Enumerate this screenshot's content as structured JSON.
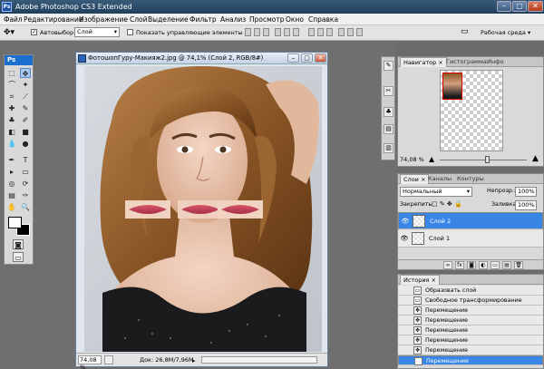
{
  "app": {
    "title": "Adobe Photoshop CS3 Extended",
    "logo": "Ps"
  },
  "menu": [
    "Файл",
    "Редактирование",
    "Изображение",
    "Слой",
    "Выделение",
    "Фильтр",
    "Анализ",
    "Просмотр",
    "Окно",
    "Справка"
  ],
  "options": {
    "autoselect_label": "Автовыбор:",
    "autoselect_value": "Слой",
    "show_controls_label": "Показать управляющие элементы",
    "workspace_label": "Рабочая среда"
  },
  "document": {
    "title": "ФотошопГуру-Макияж2.jpg @ 74,1% (Слой 2, RGB/8#)",
    "zoom": "74,08 %",
    "info": "Док: 26,8M/7,96M"
  },
  "navigator": {
    "tabs": [
      "Навигатор",
      "Гистограмма",
      "Инфо"
    ],
    "active_tab": 0,
    "zoom": "74,08 %",
    "zoom_level_fraction": 0.55
  },
  "layers": {
    "tabs": [
      "Слои",
      "Каналы",
      "Контуры"
    ],
    "active_tab": 0,
    "blend_mode": "Нормальный",
    "opacity_label": "Непрозр.:",
    "opacity_value": "100%",
    "lock_label": "Закрепить:",
    "fill_label": "Заливка:",
    "fill_value": "100%",
    "items": [
      {
        "name": "Слой 2",
        "selected": true
      },
      {
        "name": "Слой 1",
        "selected": false
      }
    ]
  },
  "history": {
    "tabs": [
      "История"
    ],
    "items": [
      {
        "name": "Образовать слой"
      },
      {
        "name": "Свободное трансформирование"
      },
      {
        "name": "Перемещение"
      },
      {
        "name": "Перемещение"
      },
      {
        "name": "Перемещение"
      },
      {
        "name": "Перемещение"
      },
      {
        "name": "Перемещение"
      },
      {
        "name": "Перемещение"
      }
    ]
  },
  "colors": {
    "accent": "#3a86e6",
    "titlebar": "#2a4a6e",
    "workspace": "#6f6f6f"
  }
}
